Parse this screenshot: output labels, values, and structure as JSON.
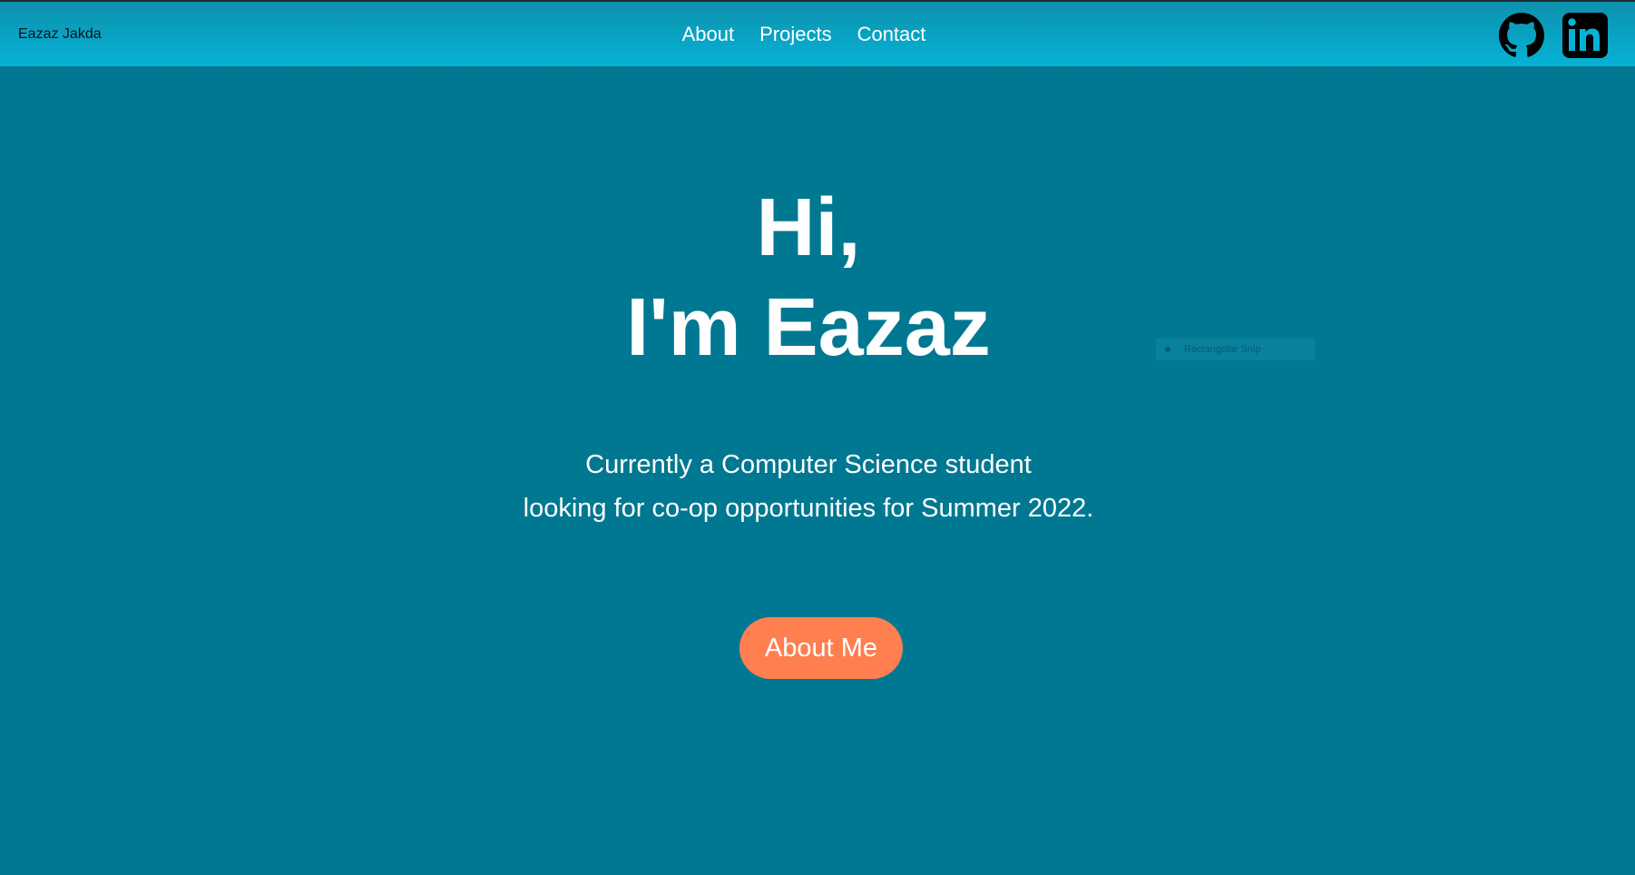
{
  "header": {
    "brand": "Eazaz Jakda",
    "nav": [
      "About",
      "Projects",
      "Contact"
    ],
    "social_icons": [
      "github-icon",
      "linkedin-icon"
    ]
  },
  "hero": {
    "greeting": [
      "Hi,",
      "I'm Eazaz"
    ],
    "subtitle": [
      "Currently a Computer Science student",
      "looking for co-op opportunities for Summer 2022."
    ],
    "cta_label": "About Me"
  },
  "overlay": {
    "snip_label": "Rectangular Snip"
  },
  "colors": {
    "page_background": "#007891",
    "header_gradient_top": "#0d91ad",
    "header_gradient_bottom": "#06b2d6",
    "cta_background": "#ff7f50",
    "text": "#ffffff",
    "icon": "#000000"
  }
}
